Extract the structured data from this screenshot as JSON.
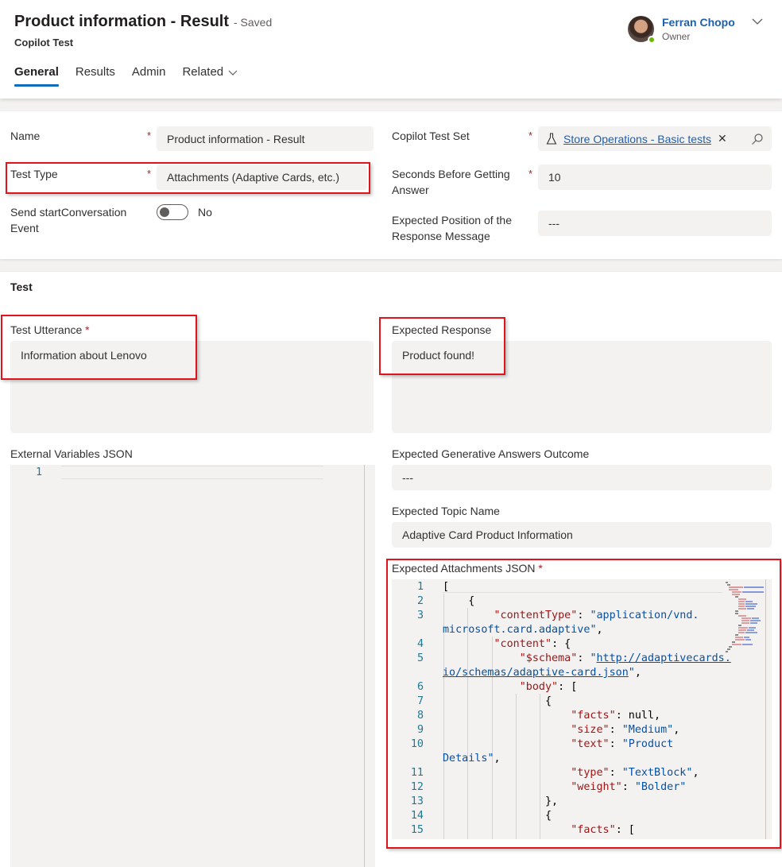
{
  "header": {
    "title": "Product information - Result",
    "saved": "- Saved",
    "entity": "Copilot Test",
    "owner": {
      "name": "Ferran Chopo",
      "role": "Owner"
    },
    "tabs": [
      {
        "label": "General",
        "active": true
      },
      {
        "label": "Results"
      },
      {
        "label": "Admin"
      },
      {
        "label": "Related",
        "dropdown": true
      }
    ]
  },
  "general": {
    "name_label": "Name",
    "name_value": "Product information - Result",
    "test_type_label": "Test Type",
    "test_type_value": "Attachments (Adaptive Cards, etc.)",
    "send_start_label_1": "Send startConversation",
    "send_start_label_2": "Event",
    "send_start_value": "No",
    "test_set_label": "Copilot Test Set",
    "test_set_value": "Store Operations - Basic tests",
    "seconds_label_1": "Seconds Before Getting",
    "seconds_label_2": "Answer",
    "seconds_value": "10",
    "position_label_1": "Expected Position of the",
    "position_label_2": "Response Message",
    "position_value": "---",
    "required_mark": "*"
  },
  "test": {
    "section_title": "Test",
    "utterance_label": "Test Utterance",
    "utterance_value": "Information about Lenovo",
    "expected_response_label": "Expected Response",
    "expected_response_value": "Product found!",
    "external_vars_label": "External Variables JSON",
    "external_vars_line": "1",
    "gen_answers_label": "Expected Generative Answers Outcome",
    "gen_answers_value": "---",
    "topic_label": "Expected Topic Name",
    "topic_value": "Adaptive Card Product Information",
    "attachments_label": "Expected Attachments JSON",
    "attachments_code": [
      {
        "n": "1",
        "t": "["
      },
      {
        "n": "2",
        "t": "    {"
      },
      {
        "n": "3",
        "t": "        \"contentType\": \"application/vnd."
      },
      {
        "n": "",
        "t": "microsoft.card.adaptive\","
      },
      {
        "n": "4",
        "t": "        \"content\": {"
      },
      {
        "n": "5",
        "t": "            \"$schema\": \"http://adaptivecards."
      },
      {
        "n": "",
        "t": "io/schemas/adaptive-card.json\","
      },
      {
        "n": "6",
        "t": "            \"body\": ["
      },
      {
        "n": "7",
        "t": "                {"
      },
      {
        "n": "8",
        "t": "                    \"facts\": null,"
      },
      {
        "n": "9",
        "t": "                    \"size\": \"Medium\","
      },
      {
        "n": "10",
        "t": "                    \"text\": \"Product"
      },
      {
        "n": "",
        "t": "Details\","
      },
      {
        "n": "11",
        "t": "                    \"type\": \"TextBlock\","
      },
      {
        "n": "12",
        "t": "                    \"weight\": \"Bolder\""
      },
      {
        "n": "13",
        "t": "                },"
      },
      {
        "n": "14",
        "t": "                {"
      },
      {
        "n": "15",
        "t": "                    \"facts\": ["
      }
    ]
  },
  "icons": {
    "flask": "flask-icon",
    "search": "search-icon",
    "chevron": "chevron-down-icon"
  }
}
